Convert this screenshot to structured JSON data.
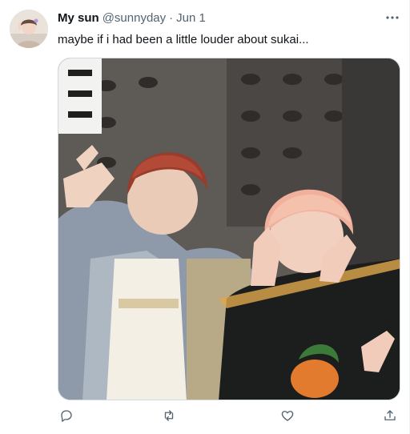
{
  "tweet": {
    "display_name": "My sun",
    "handle": "@sunnyday",
    "separator": "·",
    "date": "Jun 1",
    "text": "maybe if i had been a little louder about sukai..."
  },
  "icons": {
    "more": "more-dots-icon",
    "reply": "reply-icon",
    "retweet": "retweet-icon",
    "like": "heart-icon",
    "share": "share-icon"
  },
  "colors": {
    "text_primary": "#0f1419",
    "text_secondary": "#536471",
    "border": "#cfd9de"
  }
}
